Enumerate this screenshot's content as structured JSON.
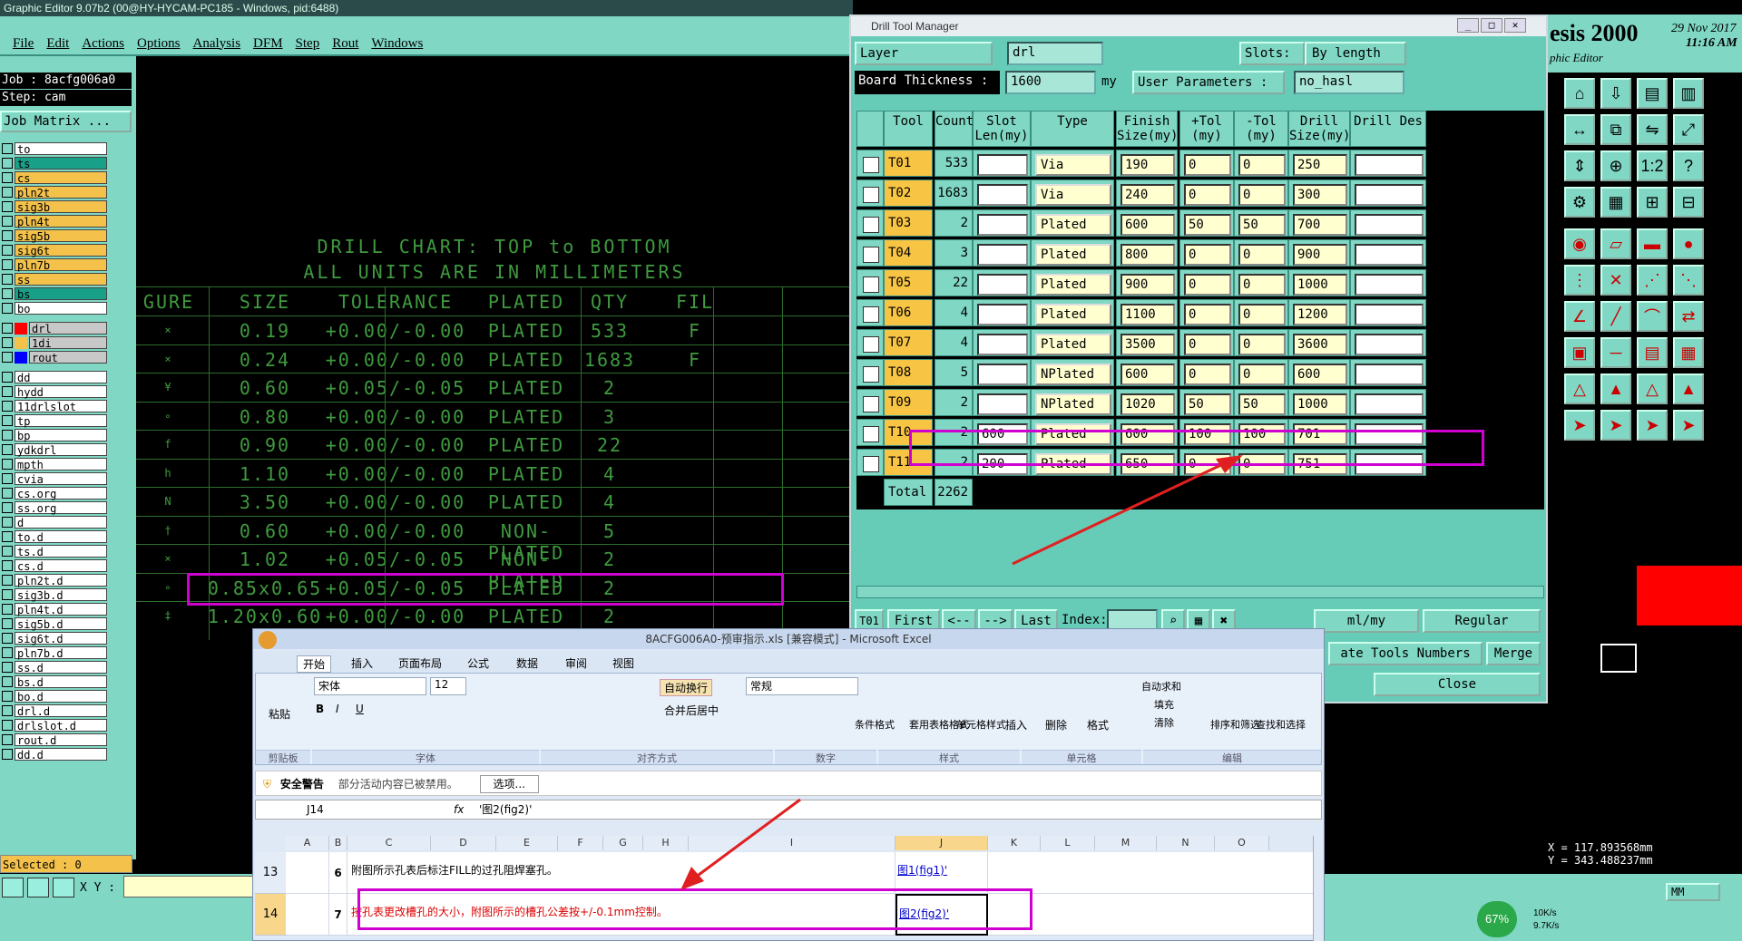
{
  "ge": {
    "title": "Graphic Editor 9.07b2 (00@HY-HYCAM-PC185 - Windows, pid:6488)",
    "menu": [
      "File",
      "Edit",
      "Actions",
      "Options",
      "Analysis",
      "DFM",
      "Step",
      "Rout",
      "Windows"
    ],
    "job": "Job : 8acfg006a0",
    "step": "Step: cam",
    "job_matrix": "Job Matrix ...",
    "layers": [
      {
        "name": "to",
        "color": "#ffffff"
      },
      {
        "name": "ts",
        "color": "#18a088"
      },
      {
        "name": "cs",
        "color": "#f4c24a"
      },
      {
        "name": "pln2t",
        "color": "#f4c24a"
      },
      {
        "name": "sig3b",
        "color": "#f4c24a"
      },
      {
        "name": "pln4t",
        "color": "#f4c24a"
      },
      {
        "name": "sig5b",
        "color": "#f4c24a"
      },
      {
        "name": "sig6t",
        "color": "#f4c24a"
      },
      {
        "name": "pln7b",
        "color": "#f4c24a"
      },
      {
        "name": "ss",
        "color": "#f4c24a"
      },
      {
        "name": "bs",
        "color": "#18a088"
      },
      {
        "name": "bo",
        "color": "#ffffff"
      }
    ],
    "drill_layers": [
      {
        "name": "drl",
        "swatch": "#ff0000"
      },
      {
        "name": "1di",
        "swatch": "#f4c24a"
      },
      {
        "name": "rout",
        "swatch": "#0000ff"
      }
    ],
    "misc_layers": [
      "dd",
      "hydd",
      "11drlslot",
      "tp",
      "bp",
      "ydkdrl",
      "mpth",
      "cvia",
      "cs.org",
      "ss.org",
      "d",
      "to.d",
      "ts.d",
      "cs.d",
      "pln2t.d",
      "sig3b.d",
      "pln4t.d",
      "sig5b.d",
      "sig6t.d",
      "pln7b.d",
      "ss.d",
      "bs.d",
      "bo.d",
      "drl.d",
      "drlslot.d",
      "rout.d",
      "dd.d"
    ],
    "selected": "Selected : 0",
    "xy_label": "X Y :"
  },
  "chart": {
    "title1": "DRILL CHART: TOP to BOTTOM",
    "title2": "ALL UNITS ARE IN MILLIMETERS",
    "headers": [
      "GURE",
      "SIZE",
      "TOLERANCE",
      "PLATED",
      "QTY",
      "FIL"
    ],
    "rows": [
      {
        "fig": "⨯",
        "size": "0.19",
        "tol": "+0.00/-0.00",
        "plated": "PLATED",
        "qty": "533",
        "fil": "F"
      },
      {
        "fig": "⨯",
        "size": "0.24",
        "tol": "+0.00/-0.00",
        "plated": "PLATED",
        "qty": "1683",
        "fil": "F"
      },
      {
        "fig": "¥",
        "size": "0.60",
        "tol": "+0.05/-0.05",
        "plated": "PLATED",
        "qty": "2",
        "fil": ""
      },
      {
        "fig": "∘",
        "size": "0.80",
        "tol": "+0.00/-0.00",
        "plated": "PLATED",
        "qty": "3",
        "fil": ""
      },
      {
        "fig": "f",
        "size": "0.90",
        "tol": "+0.00/-0.00",
        "plated": "PLATED",
        "qty": "22",
        "fil": ""
      },
      {
        "fig": "h",
        "size": "1.10",
        "tol": "+0.00/-0.00",
        "plated": "PLATED",
        "qty": "4",
        "fil": ""
      },
      {
        "fig": "N",
        "size": "3.50",
        "tol": "+0.00/-0.00",
        "plated": "PLATED",
        "qty": "4",
        "fil": ""
      },
      {
        "fig": "†",
        "size": "0.60",
        "tol": "+0.00/-0.00",
        "plated": "NON-PLATED",
        "qty": "5",
        "fil": ""
      },
      {
        "fig": "⨯",
        "size": "1.02",
        "tol": "+0.05/-0.05",
        "plated": "NON-PLATED",
        "qty": "2",
        "fil": ""
      },
      {
        "fig": "∘",
        "size": "0.85x0.65",
        "tol": "+0.05/-0.05",
        "plated": "PLATED",
        "qty": "2",
        "fil": ""
      },
      {
        "fig": "‡",
        "size": "1.20x0.60",
        "tol": "+0.00/-0.00",
        "plated": "PLATED",
        "qty": "2",
        "fil": ""
      }
    ]
  },
  "dtm": {
    "title": "Drill Tool Manager",
    "layer_label": "Layer",
    "layer_value": "drl",
    "slots_label": "Slots:",
    "slots_value": "By length",
    "board_label": "Board Thickness :",
    "board_value": "1600",
    "board_unit": "my",
    "user_params_label": "User Parameters :",
    "user_params_value": "no_hasl",
    "columns": [
      "Tool",
      "Count",
      "Slot Len(my)",
      "Type",
      "Finish Size(my)",
      "+Tol (my)",
      "-Tol (my)",
      "Drill Size(my)",
      "Drill Des"
    ],
    "rows": [
      {
        "tool": "T01",
        "count": "533",
        "slot": "",
        "type": "Via",
        "finish": "190",
        "ptol": "0",
        "ntol": "0",
        "drill": "250",
        "des": ""
      },
      {
        "tool": "T02",
        "count": "1683",
        "slot": "",
        "type": "Via",
        "finish": "240",
        "ptol": "0",
        "ntol": "0",
        "drill": "300",
        "des": ""
      },
      {
        "tool": "T03",
        "count": "2",
        "slot": "",
        "type": "Plated",
        "finish": "600",
        "ptol": "50",
        "ntol": "50",
        "drill": "700",
        "des": ""
      },
      {
        "tool": "T04",
        "count": "3",
        "slot": "",
        "type": "Plated",
        "finish": "800",
        "ptol": "0",
        "ntol": "0",
        "drill": "900",
        "des": ""
      },
      {
        "tool": "T05",
        "count": "22",
        "slot": "",
        "type": "Plated",
        "finish": "900",
        "ptol": "0",
        "ntol": "0",
        "drill": "1000",
        "des": ""
      },
      {
        "tool": "T06",
        "count": "4",
        "slot": "",
        "type": "Plated",
        "finish": "1100",
        "ptol": "0",
        "ntol": "0",
        "drill": "1200",
        "des": ""
      },
      {
        "tool": "T07",
        "count": "4",
        "slot": "",
        "type": "Plated",
        "finish": "3500",
        "ptol": "0",
        "ntol": "0",
        "drill": "3600",
        "des": ""
      },
      {
        "tool": "T08",
        "count": "5",
        "slot": "",
        "type": "NPlated",
        "finish": "600",
        "ptol": "0",
        "ntol": "0",
        "drill": "600",
        "des": ""
      },
      {
        "tool": "T09",
        "count": "2",
        "slot": "",
        "type": "NPlated",
        "finish": "1020",
        "ptol": "50",
        "ntol": "50",
        "drill": "1000",
        "des": ""
      },
      {
        "tool": "T10",
        "count": "2",
        "slot": "600",
        "type": "Plated",
        "finish": "600",
        "ptol": "100",
        "ntol": "100",
        "drill": "701",
        "des": ""
      },
      {
        "tool": "T11",
        "count": "2",
        "slot": "200",
        "type": "Plated",
        "finish": "650",
        "ptol": "0",
        "ntol": "0",
        "drill": "751",
        "des": ""
      }
    ],
    "total_label": "Total",
    "total_value": "2262",
    "nav": {
      "tool": "T01",
      "first": "First",
      "prev": "<--",
      "next": "-->",
      "last": "Last",
      "index": "Index:"
    },
    "units": "ml/my",
    "mode": "Regular",
    "update_tools": "ate Tools Numbers",
    "merge": "Merge",
    "close": "Close"
  },
  "right": {
    "brand": "esis 2000",
    "subtitle": "phic Editor",
    "date": "29 Nov 2017",
    "time": "11:16 AM",
    "coord_x": "X = 117.893568mm",
    "coord_y": "Y = 343.488237mm",
    "units_btn": "MM"
  },
  "taskbar": {
    "percent": "67%",
    "up": "10K/s",
    "down": "9.7K/s"
  },
  "excel": {
    "title": "8ACFG006A0-预审指示.xls [兼容模式] - Microsoft Excel",
    "tabs": [
      "开始",
      "插入",
      "页面布局",
      "公式",
      "数据",
      "审阅",
      "视图"
    ],
    "paste": "粘贴",
    "font_name": "宋体",
    "font_size": "12",
    "wrap": "自动换行",
    "merge_center": "合并后居中",
    "number_format": "常规",
    "cond_format": "条件格式",
    "table_format": "套用表格格式",
    "cell_style": "单元格样式",
    "insert": "插入",
    "delete": "删除",
    "format": "格式",
    "autosum": "自动求和",
    "fill": "填充",
    "clear": "清除",
    "sort": "排序和筛选",
    "find": "查找和选择",
    "groups": [
      "剪贴板",
      "字体",
      "对齐方式",
      "数字",
      "样式",
      "单元格",
      "编辑"
    ],
    "warning_title": "安全警告",
    "warning_text": "部分活动内容已被禁用。",
    "options": "选项...",
    "name_box": "J14",
    "formula": "'图2(fig2)'",
    "columns": [
      "A",
      "B",
      "C",
      "D",
      "E",
      "F",
      "G",
      "H",
      "I",
      "J",
      "K",
      "L",
      "M",
      "N",
      "O"
    ],
    "row13": {
      "num": "13",
      "idx": "6",
      "text": "附图所示孔表后标注FILL的过孔阻焊塞孔。",
      "link": "图1(fig1)'"
    },
    "row14": {
      "num": "14",
      "idx": "7",
      "text": "按孔表更改槽孔的大小，附图所示的槽孔公差按+/-0.1mm控制。",
      "link": "图2(fig2)'"
    }
  }
}
